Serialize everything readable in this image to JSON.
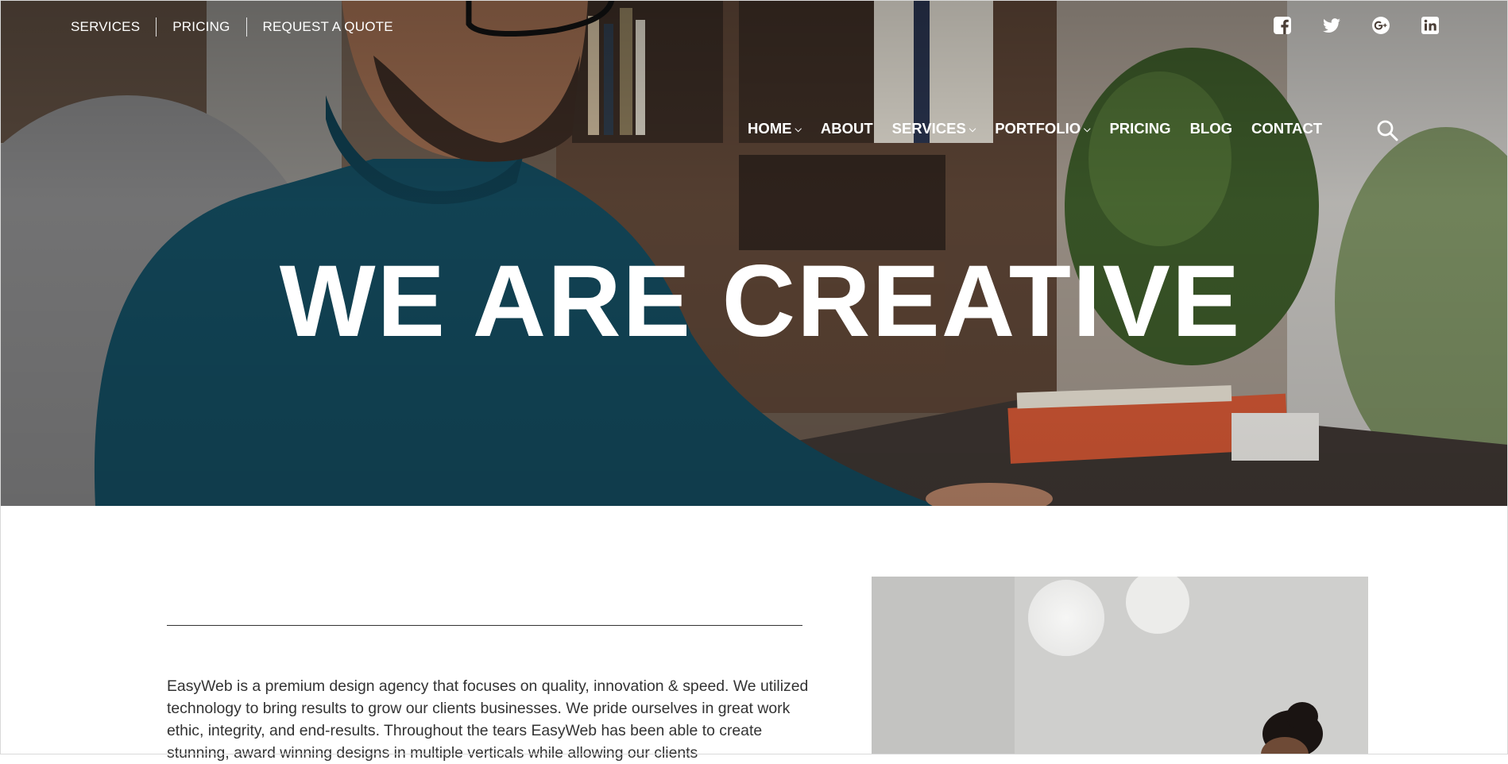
{
  "top_bar": {
    "links": [
      "SERVICES",
      "PRICING",
      "REQUEST A QUOTE"
    ],
    "social": [
      "facebook-icon",
      "twitter-icon",
      "google-plus-icon",
      "linkedin-icon"
    ]
  },
  "nav": {
    "items": [
      {
        "label": "HOME",
        "dropdown": true
      },
      {
        "label": "ABOUT",
        "dropdown": false
      },
      {
        "label": "SERVICES",
        "dropdown": true
      },
      {
        "label": "PORTFOLIO",
        "dropdown": true
      },
      {
        "label": "PRICING",
        "dropdown": false
      },
      {
        "label": "BLOG",
        "dropdown": false
      },
      {
        "label": "CONTACT",
        "dropdown": false
      }
    ],
    "search_icon": "search-icon"
  },
  "hero": {
    "headline": "WE ARE CREATIVE"
  },
  "about": {
    "text": "EasyWeb is a premium design agency that focuses on quality, innovation & speed. We utilized technology to bring results to grow our clients businesses. We pride ourselves in great work ethic, integrity, and end-results. Throughout the tears EasyWeb has been able to create stunning, award winning designs in multiple verticals while allowing our clients"
  },
  "colors": {
    "nav_text": "#ffffff",
    "body_text": "#333333",
    "divider": "#333333",
    "sweater": "#13495c"
  }
}
